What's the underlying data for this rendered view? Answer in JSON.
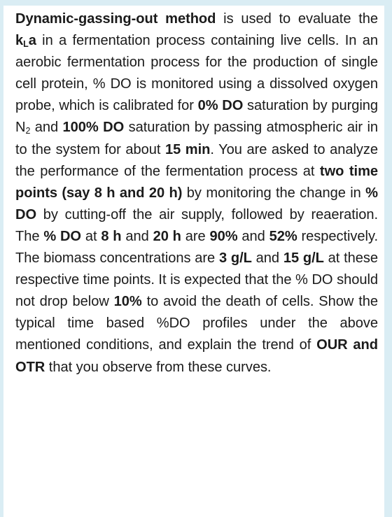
{
  "document": {
    "type": "problem-statement",
    "background_color": "#ffffff",
    "text_color": "#1b1b1b",
    "border_band_color": "#daedf4",
    "alignment": "justified",
    "paragraph": {
      "runs": [
        {
          "text": "Dynamic-gassing-out method",
          "bold": true
        },
        {
          "text": " is used to evaluate the ",
          "bold": false
        },
        {
          "text": "k",
          "bold": true
        },
        {
          "text": "L",
          "bold": true,
          "subscript": true
        },
        {
          "text": "a",
          "bold": true
        },
        {
          "text": " in a fermentation process containing live cells. In an aerobic fermentation process for the production of single cell protein, % DO is monitored using a dissolved oxygen probe, which is calibrated for ",
          "bold": false
        },
        {
          "text": "0% DO",
          "bold": true
        },
        {
          "text": " saturation by purging N",
          "bold": false
        },
        {
          "text": "2",
          "bold": false,
          "subscript": true
        },
        {
          "text": " and ",
          "bold": false
        },
        {
          "text": "100% DO",
          "bold": true
        },
        {
          "text": " saturation by passing atmospheric air in to the system for about ",
          "bold": false
        },
        {
          "text": "15 min",
          "bold": true
        },
        {
          "text": ". You are asked to analyze the performance of the fermentation process at ",
          "bold": false
        },
        {
          "text": "two time points (say 8 h and 20 h)",
          "bold": true
        },
        {
          "text": " by monitoring the change in ",
          "bold": false
        },
        {
          "text": "% DO",
          "bold": true
        },
        {
          "text": " by cutting-off the air supply, followed by reaeration. The ",
          "bold": false
        },
        {
          "text": "% DO",
          "bold": true
        },
        {
          "text": " at ",
          "bold": false
        },
        {
          "text": "8 h",
          "bold": true
        },
        {
          "text": " and ",
          "bold": false
        },
        {
          "text": "20 h",
          "bold": true
        },
        {
          "text": " are ",
          "bold": false
        },
        {
          "text": "90%",
          "bold": true
        },
        {
          "text": " and ",
          "bold": false
        },
        {
          "text": "52%",
          "bold": true
        },
        {
          "text": " respectively. The biomass concentrations are ",
          "bold": false
        },
        {
          "text": "3 g/L",
          "bold": true
        },
        {
          "text": " and ",
          "bold": false
        },
        {
          "text": "15 g/L",
          "bold": true
        },
        {
          "text": " at these respective time points. It is expected that the % DO should not drop below ",
          "bold": false
        },
        {
          "text": "10%",
          "bold": true
        },
        {
          "text": " to avoid the death of cells. Show the typical time based %DO profiles under the above mentioned conditions, and explain the trend of ",
          "bold": false
        },
        {
          "text": "OUR and OTR",
          "bold": true
        },
        {
          "text": " that you observe from these curves.",
          "bold": false
        }
      ],
      "segments": {
        "s01_method_name": "Dynamic-gassing-out method",
        "s02": " is used to evaluate the ",
        "s03_kla_k": "k",
        "s04_kla_sub": "L",
        "s05_kla_a": "a",
        "s06": " in a fermentation process containing live cells. In an aerobic fermentation process for the production of single cell protein, % DO is monitored using a dissolved oxygen probe, which is calibrated for ",
        "s07_zero_do": "0% DO",
        "s08": " saturation by purging N",
        "s09_n2_sub": "2",
        "s10": " and ",
        "s11_hundred_do": "100% DO",
        "s12": " saturation by passing atmospheric air in to the system for about ",
        "s13_fifteen_min": "15 min",
        "s14": ". You are asked to analyze the performance of the fermentation process at ",
        "s15_two_time_points": "two time points (say 8 h and 20 h)",
        "s16": " by monitoring the change in ",
        "s17_pct_do": "% DO",
        "s18": " by cutting-off the air supply, followed by reaeration. The ",
        "s19_pct_do": "% DO",
        "s20": " at ",
        "s21_eight_h": "8 h",
        "s22": " and ",
        "s23_twenty_h": "20 h",
        "s24": " are ",
        "s25_ninety_pct": "90%",
        "s26": " and ",
        "s27_fiftytwo_pct": "52%",
        "s28": " respectively. The biomass concentrations are ",
        "s29_three_gl": "3 g/L",
        "s30": " and ",
        "s31_fifteen_gl": "15 g/L",
        "s32": " at these respective time points. It is expected that the % DO should not drop below ",
        "s33_ten_pct": "10%",
        "s34": " to avoid the death of cells. Show the typical time based %DO profiles under the above mentioned conditions, and explain the trend of ",
        "s35_our_otr": "OUR and OTR",
        "s36": " that you observe from these curves."
      },
      "key_values": {
        "calibration_low": "0% DO",
        "calibration_high": "100% DO",
        "purge_gas": "N2",
        "aeration_duration": "15 min",
        "time_point_1": "8 h",
        "time_point_2": "20 h",
        "do_at_time_point_1": "90%",
        "do_at_time_point_2": "52%",
        "biomass_at_time_point_1": "3 g/L",
        "biomass_at_time_point_2": "15 g/L",
        "minimum_safe_do": "10%",
        "method": "Dynamic-gassing-out method",
        "mass_transfer_coefficient": "kLa",
        "terms_to_explain": "OUR and OTR"
      }
    }
  }
}
